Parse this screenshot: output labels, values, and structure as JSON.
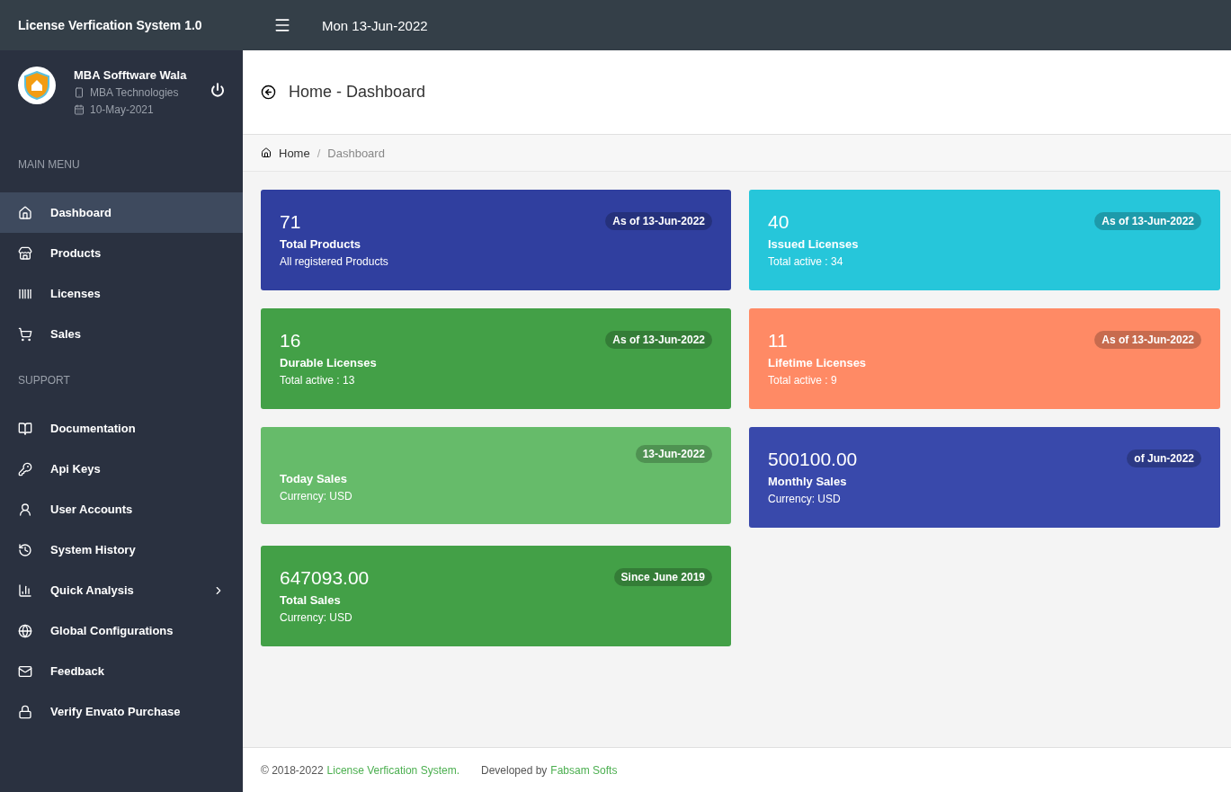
{
  "topbar": {
    "title": "License Verfication System 1.0",
    "date": "Mon 13-Jun-2022"
  },
  "profile": {
    "name": "MBA Sofftware Wala",
    "company": "MBA Technologies",
    "date": "10-May-2021"
  },
  "sidebar": {
    "sections": [
      {
        "title": "MAIN MENU",
        "items": [
          {
            "label": "Dashboard",
            "selected": true,
            "has_submenu": false
          },
          {
            "label": "Products",
            "selected": false,
            "has_submenu": false
          },
          {
            "label": "Licenses",
            "selected": false,
            "has_submenu": false
          },
          {
            "label": "Sales",
            "selected": false,
            "has_submenu": false
          }
        ]
      },
      {
        "title": "SUPPORT",
        "items": [
          {
            "label": "Documentation",
            "selected": false,
            "has_submenu": false
          },
          {
            "label": "Api Keys",
            "selected": false,
            "has_submenu": false
          },
          {
            "label": "User Accounts",
            "selected": false,
            "has_submenu": false
          },
          {
            "label": "System History",
            "selected": false,
            "has_submenu": false
          },
          {
            "label": "Quick Analysis",
            "selected": false,
            "has_submenu": true
          },
          {
            "label": "Global Configurations",
            "selected": false,
            "has_submenu": false
          },
          {
            "label": "Feedback",
            "selected": false,
            "has_submenu": false
          },
          {
            "label": "Verify Envato Purchase",
            "selected": false,
            "has_submenu": false
          }
        ]
      }
    ]
  },
  "page_header": {
    "title": "Home",
    "separator": "-",
    "subtitle": "Dashboard"
  },
  "breadcrumb_separator": "/",
  "breadcrumb": [
    {
      "label": "Home",
      "selected": false
    },
    {
      "label": "Dashboard",
      "selected": true
    }
  ],
  "cards": [
    {
      "value": "71",
      "title": "Total Products",
      "subtitle": "All registered Products",
      "badge": "As of 13-Jun-2022",
      "color": "#303f9f"
    },
    {
      "value": "40",
      "title": "Issued Licenses",
      "subtitle": "Total active : 34",
      "badge": "As of 13-Jun-2022",
      "color": "#26c6da"
    },
    {
      "value": "16",
      "title": "Durable Licenses",
      "subtitle": "Total active : 13",
      "badge": "As of 13-Jun-2022",
      "color": "#43a047"
    },
    {
      "value": "11",
      "title": "Lifetime Licenses",
      "subtitle": "Total active : 9",
      "badge": "As of 13-Jun-2022",
      "color": "#ff8a65"
    },
    {
      "title": "Today Sales",
      "subtitle": "Currency: USD",
      "badge": "13-Jun-2022",
      "color": "#66bb6a"
    },
    {
      "value": "500100.00",
      "title": "Monthly Sales",
      "subtitle": "Currency: USD",
      "badge": "of Jun-2022",
      "color": "#3949ab"
    },
    {
      "value": "647093.00",
      "title": "Total Sales",
      "subtitle": "Currency: USD",
      "badge": "Since June 2019",
      "color": "#43a047"
    }
  ],
  "footer": {
    "copyright": "© 2018-2022",
    "system_link": "License Verfication System.",
    "developed_by": "Developed by",
    "developer_link": "Fabsam Softs"
  }
}
